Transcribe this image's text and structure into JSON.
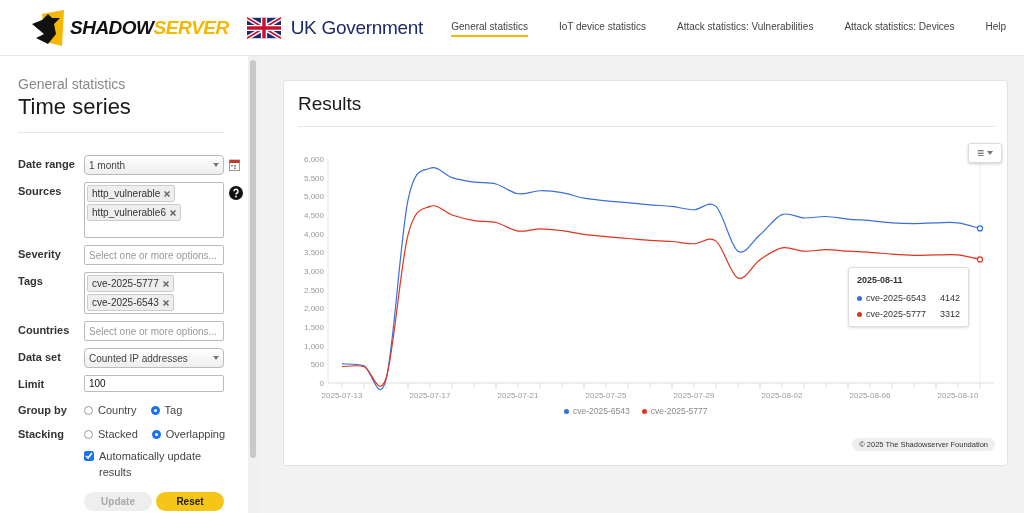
{
  "header": {
    "logo": {
      "part_1": "SHADOW",
      "part_2": "SERVER"
    },
    "partner": "UK Government",
    "nav": [
      {
        "label": "General statistics",
        "selected": true
      },
      {
        "label": "IoT device statistics",
        "selected": false
      },
      {
        "label": "Attack statistics: Vulnerabilities",
        "selected": false
      },
      {
        "label": "Attack statistics: Devices",
        "selected": false
      },
      {
        "label": "Help",
        "selected": false
      }
    ]
  },
  "sidebar": {
    "breadcrumb": "General statistics",
    "title": "Time series",
    "fields": [
      {
        "kind": "select",
        "label": "Date range",
        "value": "1 month",
        "calendar": true
      },
      {
        "kind": "tags",
        "label": "Sources",
        "tags": [
          "http_vulnerable",
          "http_vulnerable6"
        ],
        "help": true,
        "tall": true
      },
      {
        "kind": "multi",
        "label": "Severity",
        "placeholder": "Select one or more options..."
      },
      {
        "kind": "tags",
        "label": "Tags",
        "tags": [
          "cve-2025-5777",
          "cve-2025-6543"
        ],
        "help": false,
        "tall": false
      },
      {
        "kind": "multi",
        "label": "Countries",
        "placeholder": "Select one or more options..."
      },
      {
        "kind": "select",
        "label": "Data set",
        "value": "Counted IP addresses",
        "calendar": false
      },
      {
        "kind": "text",
        "label": "Limit",
        "value": "100"
      },
      {
        "kind": "radio",
        "label": "Group by",
        "options": [
          {
            "label": "Country",
            "selected": false
          },
          {
            "label": "Tag",
            "selected": true
          }
        ]
      },
      {
        "kind": "radio",
        "label": "Stacking",
        "options": [
          {
            "label": "Stacked",
            "selected": false
          },
          {
            "label": "Overlapping",
            "selected": true
          }
        ]
      }
    ],
    "auto_update": {
      "label": "Automatically update results",
      "checked": true
    },
    "buttons": [
      {
        "label": "Update",
        "disabled": true
      },
      {
        "label": "Reset",
        "disabled": false
      }
    ]
  },
  "results": {
    "title": "Results",
    "chart_data": {
      "type": "line",
      "categories": [
        "2025-07-13",
        null,
        null,
        null,
        "2025-07-17",
        null,
        null,
        null,
        "2025-07-21",
        null,
        null,
        null,
        "2025-07-25",
        null,
        null,
        null,
        "2025-07-29",
        null,
        null,
        null,
        "2025-08-02",
        null,
        null,
        null,
        "2025-08-06",
        null,
        null,
        null,
        "2025-08-10",
        null
      ],
      "series": [
        {
          "name": "cve-2025-6543",
          "color": "#3b6fd8",
          "values": [
            510,
            460,
            90,
            4900,
            5750,
            5500,
            5380,
            5330,
            5070,
            5150,
            5100,
            4950,
            4880,
            4830,
            4770,
            4730,
            4640,
            4730,
            3530,
            3970,
            4510,
            4420,
            4460,
            4390,
            4350,
            4290,
            4270,
            4290,
            4290,
            4140
          ]
        },
        {
          "name": "cve-2025-5777",
          "color": "#e0341f",
          "values": [
            440,
            440,
            120,
            3970,
            4730,
            4500,
            4350,
            4300,
            4070,
            4130,
            4080,
            3980,
            3920,
            3870,
            3820,
            3790,
            3730,
            3800,
            2810,
            3300,
            3620,
            3530,
            3570,
            3530,
            3500,
            3450,
            3420,
            3430,
            3430,
            3310
          ]
        }
      ],
      "ylim": [
        0,
        6000
      ],
      "yticks": [
        {
          "value": 0,
          "label": "0"
        },
        {
          "value": 500,
          "label": "500"
        },
        {
          "value": 1000,
          "label": "1,000"
        },
        {
          "value": 1500,
          "label": "1,500"
        },
        {
          "value": 2000,
          "label": "2,000"
        },
        {
          "value": 2500,
          "label": "2,500"
        },
        {
          "value": 3000,
          "label": "3,000"
        },
        {
          "value": 3500,
          "label": "3,500"
        },
        {
          "value": 4000,
          "label": "4,000"
        },
        {
          "value": 4500,
          "label": "4,500"
        },
        {
          "value": 5000,
          "label": "5,000"
        },
        {
          "value": 5500,
          "label": "5,500"
        },
        {
          "value": 6000,
          "label": "6,000"
        }
      ]
    },
    "menu_icon": "≡",
    "tooltip": {
      "title": "2025-08-11",
      "rows": [
        {
          "name": "cve-2025-6543",
          "value": "4142",
          "color": "#3b6fd8"
        },
        {
          "name": "cve-2025-5777",
          "value": "3312",
          "color": "#e0341f"
        }
      ]
    },
    "credits": "© 2025 The Shadowserver Foundation"
  }
}
